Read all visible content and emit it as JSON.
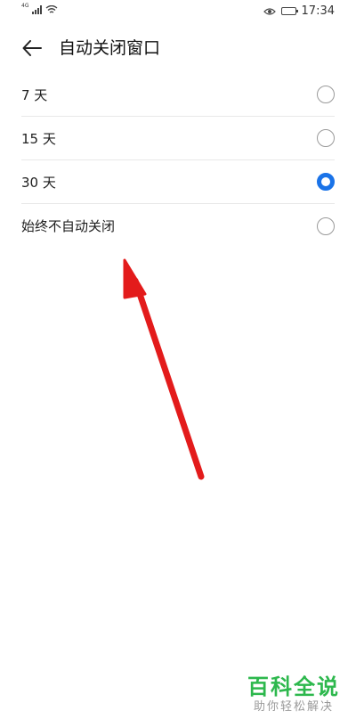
{
  "status_bar": {
    "network": "4G",
    "time": "17:34",
    "icons": [
      "signal-icon",
      "wifi-icon",
      "eye-icon",
      "battery-icon"
    ]
  },
  "header": {
    "back_icon": "back-arrow-icon",
    "title": "自动关闭窗口"
  },
  "options": [
    {
      "label": "7 天",
      "selected": false
    },
    {
      "label": "15 天",
      "selected": false
    },
    {
      "label": "30 天",
      "selected": true
    },
    {
      "label": "始终不自动关闭",
      "selected": false
    }
  ],
  "colors": {
    "accent": "#1a73e8",
    "arrow": "#e31b1b",
    "watermark": "#2db84d"
  },
  "watermark": {
    "title": "百科全说",
    "subtitle": "助你轻松解决"
  }
}
